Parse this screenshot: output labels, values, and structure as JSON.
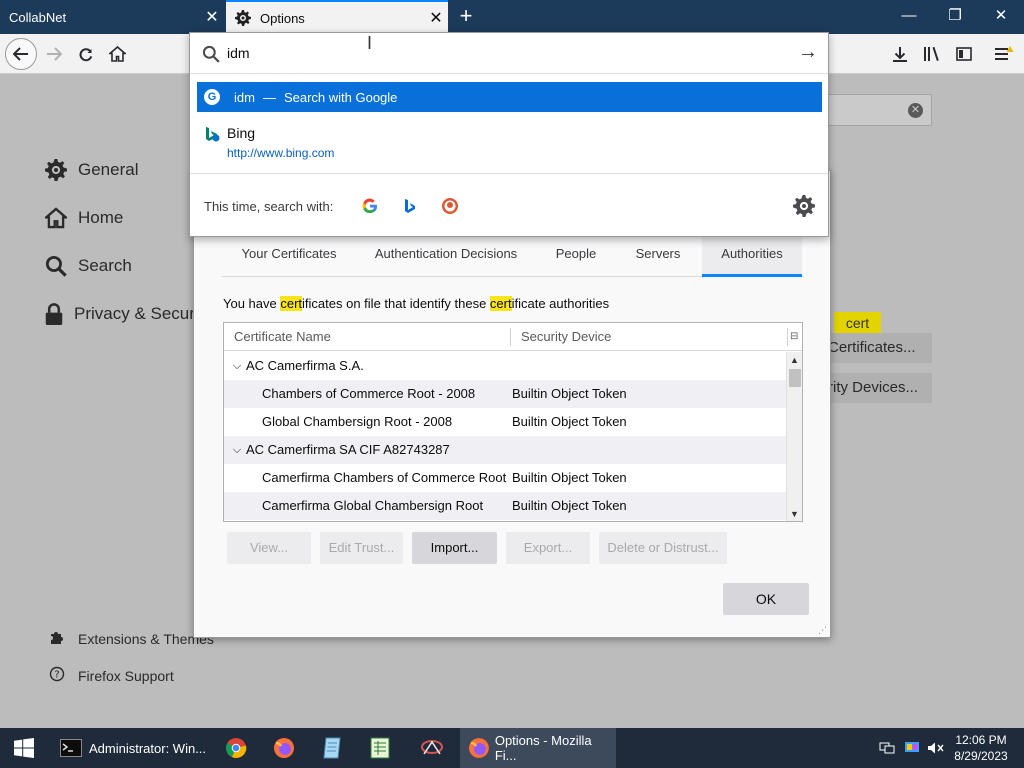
{
  "tabs": [
    {
      "title": "CollabNet"
    },
    {
      "title": "Options"
    }
  ],
  "window_controls": {
    "minimize": "—",
    "maximize": "❐",
    "close": "✕"
  },
  "urlbar": {
    "query": "idm",
    "suggestions": {
      "primary": {
        "term": "idm",
        "separator": "—",
        "action": "Search with Google"
      },
      "bing": {
        "name": "Bing",
        "url": "http://www.bing.com"
      }
    },
    "one_off_label": "This time, search with:",
    "engines": [
      "google-icon",
      "bing-icon",
      "duckduckgo-icon"
    ]
  },
  "sidebar": {
    "items": [
      {
        "label": "General",
        "icon": "gear-icon"
      },
      {
        "label": "Home",
        "icon": "home-icon"
      },
      {
        "label": "Search",
        "icon": "search-icon"
      },
      {
        "label": "Privacy & Security",
        "icon": "lock-icon"
      }
    ],
    "footer": [
      {
        "label": "Extensions & Themes",
        "icon": "puzzle-icon"
      },
      {
        "label": "Firefox Support",
        "icon": "help-icon"
      }
    ]
  },
  "page": {
    "find_term": "cert",
    "view_certificates_label": "Certificates...",
    "security_devices_label": "rity Devices..."
  },
  "dialog": {
    "tabs": [
      "Your Certificates",
      "Authentication Decisions",
      "People",
      "Servers",
      "Authorities"
    ],
    "selected_tab": "Authorities",
    "note": {
      "a": "You have ",
      "b": "cert",
      "c": "ificates on file that identify these ",
      "d": "cert",
      "e": "ificate authorities"
    },
    "columns": [
      "Certificate Name",
      "Security Device"
    ],
    "rows": [
      {
        "type": "group",
        "name": "AC Camerfirma S.A.",
        "device": ""
      },
      {
        "type": "item",
        "name": "Chambers of Commerce Root - 2008",
        "device": "Builtin Object Token"
      },
      {
        "type": "item",
        "name": "Global Chambersign Root - 2008",
        "device": "Builtin Object Token"
      },
      {
        "type": "group",
        "name": "AC Camerfirma SA CIF A82743287",
        "device": ""
      },
      {
        "type": "item",
        "name": "Camerfirma Chambers of Commerce Root",
        "device": "Builtin Object Token"
      },
      {
        "type": "item",
        "name": "Camerfirma Global Chambersign Root",
        "device": "Builtin Object Token"
      }
    ],
    "buttons": {
      "view": "View...",
      "edit_trust": "Edit Trust...",
      "import": "Import...",
      "export": "Export...",
      "delete": "Delete or Distrust..."
    },
    "ok": "OK"
  },
  "taskbar": {
    "cmd_window": "Administrator: Win...",
    "firefox_window": "Options - Mozilla Fi...",
    "time": "12:06 PM",
    "date": "8/29/2023"
  },
  "colors": {
    "accent": "#0a84ff",
    "highlight": "#f7e41a",
    "tabstrip": "#1c3a5a",
    "taskbar": "#1f2b3a"
  }
}
